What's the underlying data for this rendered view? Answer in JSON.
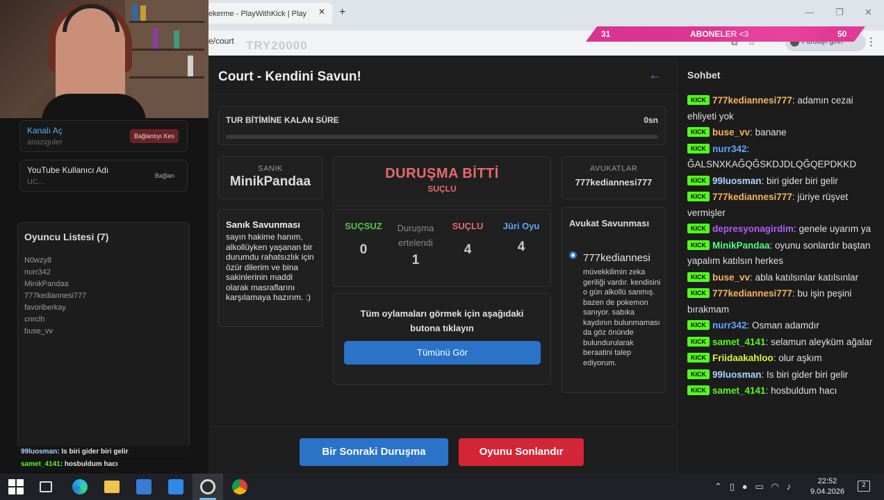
{
  "browser": {
    "tab_title": "ekerme - PlayWithKick | Play",
    "tab_close": "✕",
    "new_tab": "+",
    "url": "e/court",
    "url_overlay": "TRY20000",
    "signin_label": "Parolayı girin",
    "menu_icon": "⋮",
    "window_controls": [
      "—",
      "❐",
      "✕"
    ]
  },
  "sub_banner": {
    "left": "31",
    "center": "ABONELER <3",
    "right": "50"
  },
  "sidebar": {
    "connections": [
      {
        "title": "Kanalı Aç",
        "title_color": "#5ea8ff",
        "sub": "anaziguler",
        "button": "Bağlantıyı Kes",
        "button_color": "#8a2a2a"
      },
      {
        "title": "YouTube Kullanıcı Adı",
        "title_color": "#dddddd",
        "sub": "UC...",
        "button": "Bağlan",
        "button_color": "#181818"
      }
    ]
  },
  "player_list": {
    "title": "Oyuncu Listesi (7)",
    "players": [
      "N0wzy8",
      "nurr342",
      "MinikPandaa",
      "777kediannesi777",
      "favoriberkay",
      "cnrclh",
      "buse_vv"
    ]
  },
  "overlay_chat": [
    {
      "user": "99luosman",
      "text": ": Is biri gider biri gelir",
      "color": "#a9d6ff"
    },
    {
      "user": "samet_4141",
      "text": ": hosbuldum hacı",
      "color": "#53fc18"
    }
  ],
  "game": {
    "title": "Court - Kendini Savun!",
    "back_icon": "←",
    "timer": {
      "label": "TUR BİTİMİNE KALAN SÜRE",
      "value": "0sn",
      "remaining_fraction": 0
    },
    "defendant": {
      "label": "SANIK",
      "name": "MinikPandaa"
    },
    "verdict": {
      "title": "DURUŞMA BİTTİ",
      "result": "SUÇLU"
    },
    "lawyers": {
      "label": "AVUKATLAR",
      "name": "777kediannesi777"
    },
    "defense": {
      "title": "Sanık Savunması",
      "text": "sayın hakime hanım, alkollüyken yaşanan bir durumdu rahatsızlık için özür dilerim ve bina sakinlerinin maddi olarak masraflarını karşılamaya hazırım. :)"
    },
    "votes": [
      {
        "label": "SUÇSUZ",
        "count": "0",
        "color": "#53c74a"
      },
      {
        "label": "Duruşma ertelendi",
        "count": "1",
        "color": "#8a8a8a"
      },
      {
        "label": "SUÇLU",
        "count": "4",
        "color": "#e86a6a"
      },
      {
        "label": "Jüri Oyu",
        "count": "4",
        "color": "#5ea8ff"
      }
    ],
    "see_all": {
      "text": "Tüm oylamaları görmek için aşağıdaki butona tıklayın",
      "button": "Tümünü Gör"
    },
    "lawyer_defense": {
      "title": "Avukat Savunması",
      "name": "777kediannesi",
      "text": "müvekkilimin zeka geriliği vardır. kendisini o gün alkollü sanmış. bazen de pokemon sanıyor. sabıka kaydının bulunmaması da göz önünde bulundurularak beraatini talep ediyorum."
    },
    "buttons": {
      "next": "Bir Sonraki Duruşma",
      "end": "Oyunu Sonlandır"
    }
  },
  "chat": {
    "title": "Sohbet",
    "badge": "KICK",
    "messages": [
      {
        "user": "777kediannesi777",
        "color": "#f5b35c",
        "text": "adamın cezai ehliyeti yok"
      },
      {
        "user": "buse_vv",
        "color": "#f5b35c",
        "text": "banane"
      },
      {
        "user": "nurr342",
        "color": "#5ea8ff",
        "text": "ĞALSNXKAĞQĞSKDJDLQĞQEPDKKD"
      },
      {
        "user": "99luosman",
        "color": "#a9d6ff",
        "text": "biri gider biri gelir"
      },
      {
        "user": "777kediannesi777",
        "color": "#f5b35c",
        "text": "jüriye rüşvet vermişler"
      },
      {
        "user": "depresyonagirdim",
        "color": "#b15cf5",
        "text": "genele uyarım ya"
      },
      {
        "user": "MinikPandaa",
        "color": "#53fc88",
        "text": "oyunu sonlardır baştan yapalım katılsın herkes"
      },
      {
        "user": "buse_vv",
        "color": "#f5b35c",
        "text": "abla katılsınlar katılsınlar"
      },
      {
        "user": "777kediannesi777",
        "color": "#f5b35c",
        "text": "bu işin peşini bırakmam"
      },
      {
        "user": "nurr342",
        "color": "#5ea8ff",
        "text": "Osman adamdır"
      },
      {
        "user": "samet_4141",
        "color": "#53fc18",
        "text": "selamun aleyküm ağalar"
      },
      {
        "user": "Friidaakahloo",
        "color": "#d9f542",
        "text": "olur aşkım"
      },
      {
        "user": "99luosman",
        "color": "#a9d6ff",
        "text": "Is biri gider biri gelir"
      },
      {
        "user": "samet_4141",
        "color": "#53fc18",
        "text": "hosbuldum hacı"
      }
    ]
  },
  "taskbar": {
    "time": "22:52",
    "date": "9.04.2026",
    "notifications": "2",
    "icons": [
      "start-icon",
      "task-view-icon",
      "edge-icon",
      "file-explorer-icon",
      "store-icon",
      "mail-icon",
      "obs-icon",
      "chrome-icon"
    ]
  }
}
